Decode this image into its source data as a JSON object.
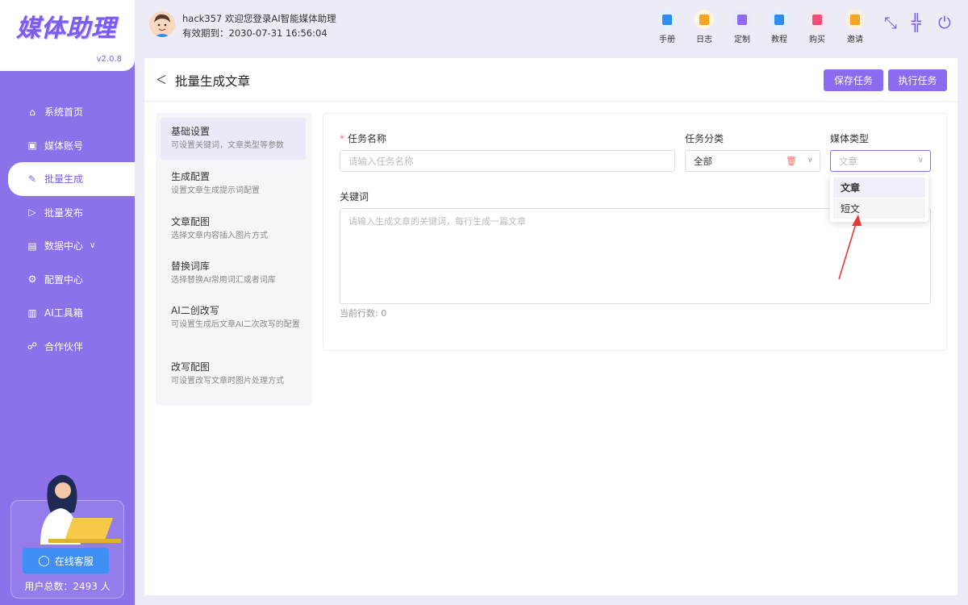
{
  "brand": {
    "logo_text": "媒体助理",
    "version": "v2.0.8"
  },
  "sidebar": {
    "items": [
      {
        "label": "系统首页",
        "icon": "home-icon"
      },
      {
        "label": "媒体账号",
        "icon": "account-icon"
      },
      {
        "label": "批量生成",
        "icon": "edit-icon",
        "active": true
      },
      {
        "label": "批量发布",
        "icon": "send-icon"
      },
      {
        "label": "数据中心",
        "icon": "data-icon",
        "has_caret": true
      },
      {
        "label": "配置中心",
        "icon": "gear-icon"
      },
      {
        "label": "AI工具箱",
        "icon": "toolbox-icon"
      },
      {
        "label": "合作伙伴",
        "icon": "partner-icon"
      }
    ],
    "support_button": "在线客服",
    "user_total": "用户总数：2493 人"
  },
  "header": {
    "welcome": "hack357 欢迎您登录AI智能媒体助理",
    "expiry": "有效期到：2030-07-31 16:56:04",
    "tools": [
      {
        "label": "手册",
        "bg": "#e3f1fe",
        "color": "#2f8cf0"
      },
      {
        "label": "日志",
        "bg": "#fff4dc",
        "color": "#f5a623"
      },
      {
        "label": "定制",
        "bg": "#ece7fb",
        "color": "#8b6cf0"
      },
      {
        "label": "教程",
        "bg": "#e3f1fe",
        "color": "#2f8cf0"
      },
      {
        "label": "购买",
        "bg": "#fde6ec",
        "color": "#f0507a"
      },
      {
        "label": "邀请",
        "bg": "#fff0dc",
        "color": "#f5a623"
      }
    ]
  },
  "page": {
    "title": "批量生成文章",
    "save_button": "保存任务",
    "run_button": "执行任务"
  },
  "steps": [
    {
      "title": "基础设置",
      "desc": "可设置关键词，文章类型等参数"
    },
    {
      "title": "生成配置",
      "desc": "设置文章生成提示词配置"
    },
    {
      "title": "文章配图",
      "desc": "选择文章内容插入图片方式"
    },
    {
      "title": "替换词库",
      "desc": "选择替换AI常用词汇或者词库"
    },
    {
      "title": "AI二创改写",
      "desc": "可设置生成后文章AI二次改写的配置"
    },
    {
      "title": "改写配图",
      "desc": "可设置改写文章时图片处理方式"
    }
  ],
  "form": {
    "task_name_label": "任务名称",
    "task_name_placeholder": "请输入任务名称",
    "category_label": "任务分类",
    "category_value": "全部",
    "media_type_label": "媒体类型",
    "media_type_placeholder": "文章",
    "keywords_label": "关键词",
    "keywords_placeholder": "请输入生成文章的关键词，每行生成一篇文章",
    "row_count": "当前行数: 0"
  },
  "media_type_options": [
    "文章",
    "短文"
  ],
  "colors": {
    "accent": "#8b6cf0",
    "sidebar": "#8b72ea",
    "support": "#3f8ff5"
  }
}
